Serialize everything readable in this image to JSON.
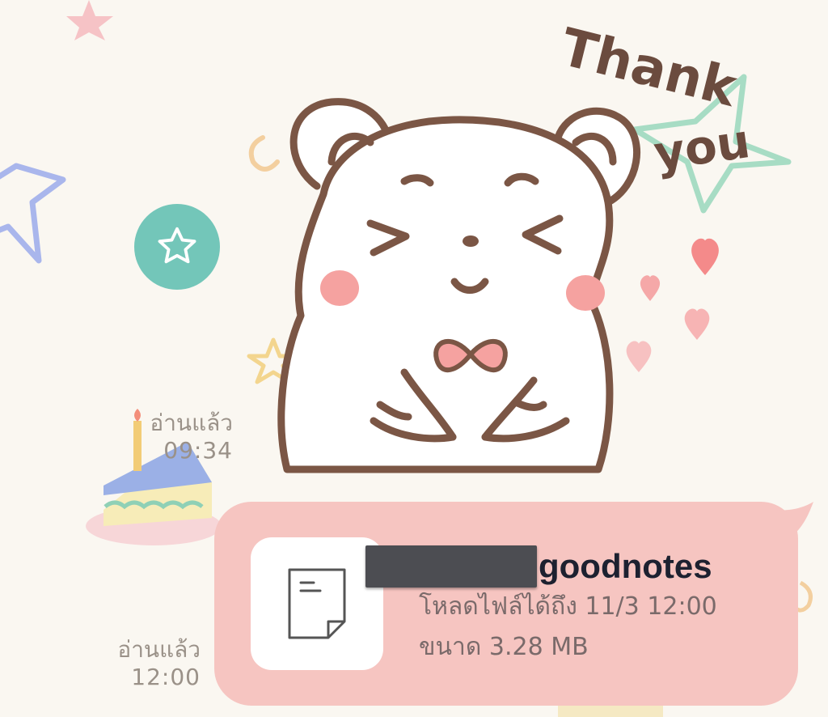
{
  "sticker": {
    "text_line1": "Thank",
    "text_line2": "you"
  },
  "star_badge": {
    "icon": "star-icon",
    "color": "#73c6b9"
  },
  "read_status_1": {
    "label": "อ่านแล้ว",
    "time": "09:34"
  },
  "read_status_2": {
    "label": "อ่านแล้ว",
    "time": "12:00"
  },
  "file_message": {
    "icon": "document-icon",
    "name_suffix": "goodnotes",
    "download_until": "โหลดไฟล์ได้ถึง 11/3 12:00",
    "size": "ขนาด 3.28 MB",
    "bubble_color": "#f6c5c1"
  }
}
